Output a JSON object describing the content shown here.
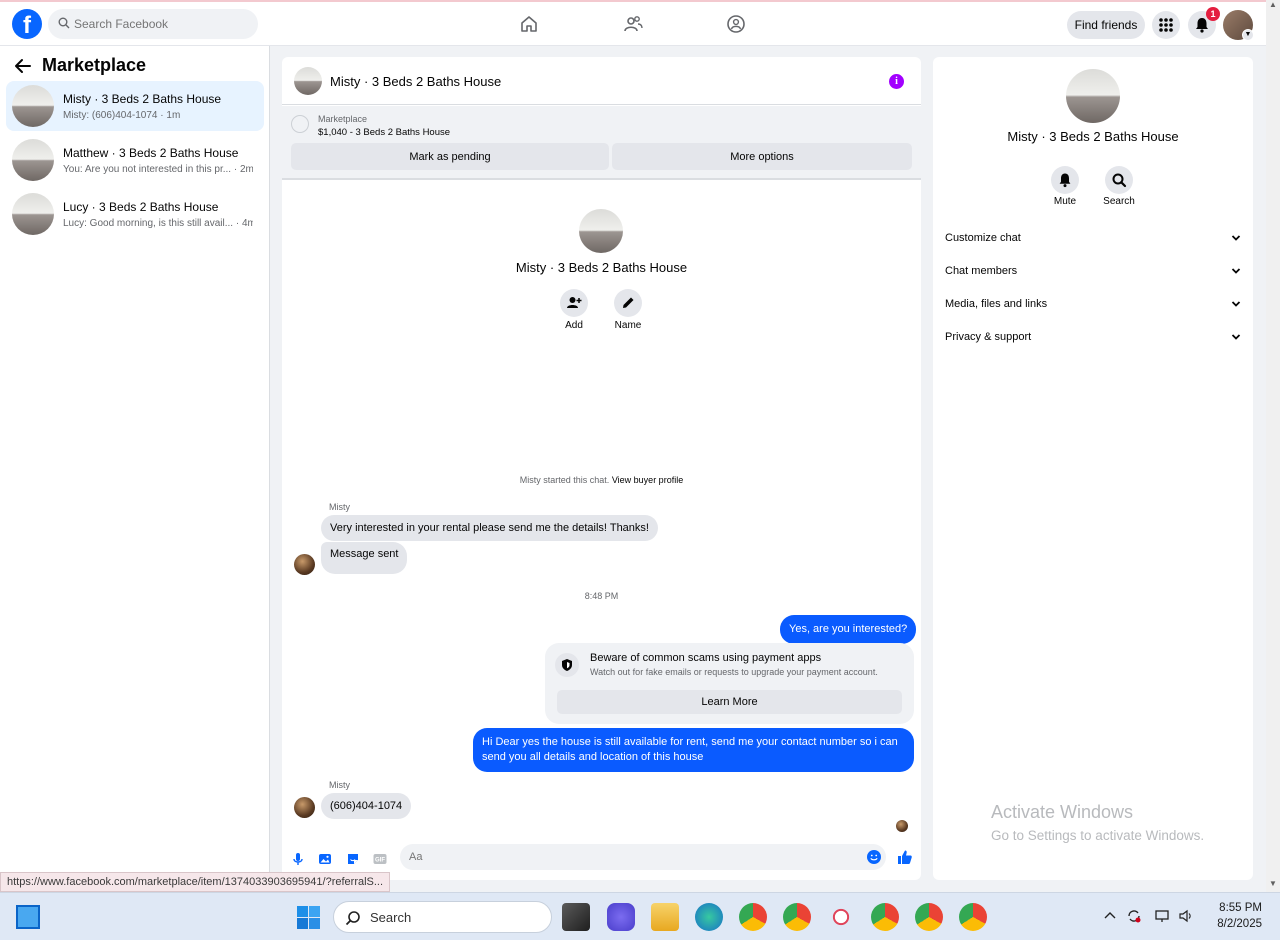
{
  "topbar": {
    "logo_letter": "f",
    "search_placeholder": "Search Facebook",
    "find_friends_label": "Find friends",
    "notification_count": "1",
    "nav_icons": [
      "home-icon",
      "friends-icon",
      "groups-icon"
    ]
  },
  "sidebar": {
    "title": "Marketplace",
    "conversations": [
      {
        "title": "Misty · 3 Beds 2 Baths House",
        "preview": "Misty: (606)404-1074 · 1m",
        "active": true
      },
      {
        "title": "Matthew · 3 Beds 2 Baths House",
        "preview": "You: Are you not interested in this pr... · 2m",
        "active": false
      },
      {
        "title": "Lucy · 3 Beds 2 Baths House",
        "preview": "Lucy: Good morning, is this still avail... · 4m",
        "active": false
      }
    ]
  },
  "chat": {
    "header_name": "Misty · 3 Beds 2 Baths House",
    "listing_label": "Marketplace",
    "listing_price": "$1,040 - 3 Beds 2 Baths House",
    "mark_pending_label": "Mark as pending",
    "more_options_label": "More options",
    "intro_name": "Misty · 3 Beds 2 Baths House",
    "intro_add_label": "Add",
    "intro_name_label": "Name",
    "started_text": "Misty started this chat.",
    "view_buyer_profile": "View buyer profile",
    "messages": {
      "sender_1": "Misty",
      "in_1": "Very interested in your rental please send me the details! Thanks!",
      "in_2": "Message sent",
      "timestamp": "8:48 PM",
      "out_1": "Yes, are you interested?",
      "warning_title": "Beware of common scams using payment apps",
      "warning_sub": "Watch out for fake emails or requests to upgrade your payment account.",
      "learn_more": "Learn More",
      "out_2": "Hi Dear yes the house is still available for rent, send me your contact number so i can send you all details and location of this house",
      "sender_2": "Misty",
      "in_3": "(606)404-1074"
    },
    "composer_placeholder": "Aa"
  },
  "right_panel": {
    "name": "Misty · 3 Beds 2 Baths House",
    "mute_label": "Mute",
    "search_label": "Search",
    "sections": [
      "Customize chat",
      "Chat members",
      "Media, files and links",
      "Privacy & support"
    ],
    "watermark_title": "Activate Windows",
    "watermark_sub": "Go to Settings to activate Windows."
  },
  "status_url": "https://www.facebook.com/marketplace/item/1374033903695941/?referralS...",
  "taskbar": {
    "search_label": "Search",
    "time": "8:55 PM",
    "date": "8/2/2025"
  },
  "colors": {
    "facebook_blue": "#0866ff",
    "outgoing_bubble": "#0a5bff",
    "info_purple": "#a200ff",
    "notification_red": "#e41e3f"
  }
}
